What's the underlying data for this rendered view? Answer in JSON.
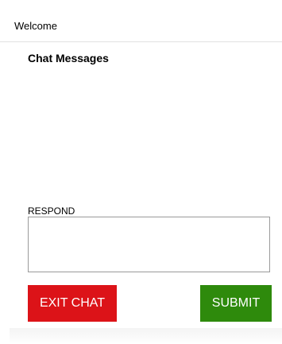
{
  "header": {
    "title": "Welcome"
  },
  "chat": {
    "section_title": "Chat Messages",
    "messages": []
  },
  "respond": {
    "label": "RESPOND",
    "value": "",
    "placeholder": ""
  },
  "actions": {
    "exit_label": "EXIT CHAT",
    "submit_label": "SUBMIT"
  },
  "colors": {
    "exit_button": "#dc1318",
    "submit_button": "#2e8a0c",
    "header_border": "#e2e2e2",
    "input_border": "#9a9a9a"
  }
}
